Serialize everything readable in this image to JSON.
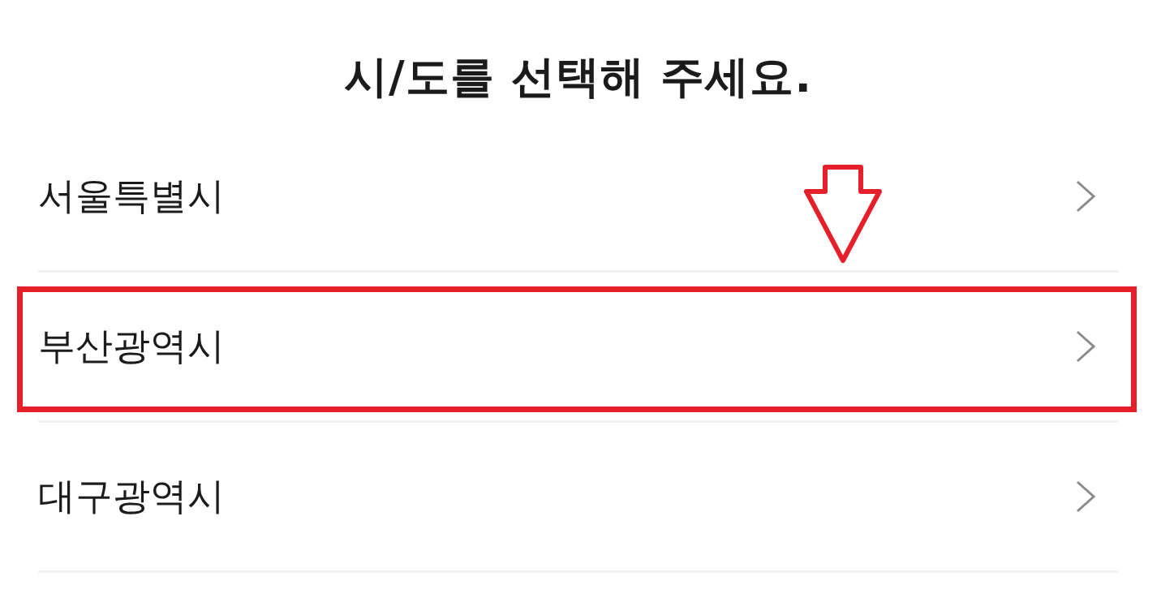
{
  "title": "시/도를 선택해 주세요.",
  "items": [
    {
      "label": "서울특별시",
      "highlighted": false
    },
    {
      "label": "부산광역시",
      "highlighted": true
    },
    {
      "label": "대구광역시",
      "highlighted": false
    }
  ]
}
